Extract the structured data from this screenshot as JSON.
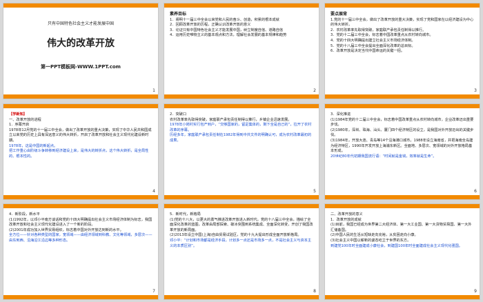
{
  "slides": [
    {
      "id": 1,
      "number": "1",
      "top_line": "只有中国特色社会主义才能发展中国",
      "title": "伟大的改革开放",
      "site": "第一PPT模板网-WWW.1PPT.com"
    },
    {
      "id": 2,
      "number": "2",
      "heading": "素养目标",
      "lines": [
        "1．阐明十一届三中全会以来党和人民的奋斗、创造，积累的根本成就",
        "2．回顾改革开放的历程，正确认识改革开放的意义",
        "3．论证只有中国特色社会主义才能发展中国，树立制度自信、道路自信",
        "4．运用历史唯物主义的基本观点和方法，理解社会发展的基本规律和趋势"
      ]
    },
    {
      "id": 3,
      "number": "3",
      "heading": "要点展背",
      "lines": [
        "1.党的十一届三中全会，做出了改革开放的重大决策，实现了党和国家在以经济建设为中心的伟大转折。",
        "2．农村改革率先取得突破，家庭联产承包责任制得以推行。",
        "3．党的十二届三中全会，标志着中国改革重点从农村转向城市。",
        "4．党的十四大明确提出建立社会主义市场经济体制。",
        "5．党的十八届三中全会提出全面深化改革的总目标。",
        "6．改革开放是决定当代中国命运的关键一招。"
      ]
    },
    {
      "id": 4,
      "number": "4",
      "lines": [
        "【学新知】",
        "一、改革开放的进程",
        "1．序幕开启",
        "1978年12月党的十一届三中全会，做出了改革开放的重大决策，实现了中华人民共和国成立以来党的历史上具有深远意义的伟大转折，开启了改革开放和社会主义现代化建设新时期。",
        "1978年，这是中国的新起点。",
        "把工作重心由阶级斗争转移到经济建设上来，是伟大的转折点，这个伟大转折，是全局性的、根本性的。"
      ]
    },
    {
      "id": 5,
      "number": "5",
      "lines": [
        "2．突破口",
        "农村改革率先取得突破，家庭联产承包责任制得以推行，乡镇企业迅速发展。",
        "1978年小岗村实行包产到户，“交够国家的，留足集体的，剩下全是自己的”，拉开了农村改革的序幕。",
        "历经多年，家庭联产承包责任制在1982年得到中共文件的明确认可，成为农村改革最初的成果。"
      ]
    },
    {
      "id": 6,
      "number": "6",
      "lines": [
        "3．深化推进",
        "(1)1984年党的十二届三中全会，标志着中国改革重点从农村转向城市，企业改革迈出重要步伐。",
        "(2)1980年，深圳、珠海、汕头、厦门四个经济特区的设立，是我国对外开放迈出的关键步伐。",
        "(3)1984年，开放大连、青岛等14个沿海港口城市。1988年设立海南省，并把海南全岛建为经济特区，1990年开发开放上海浦东新区。全面地、多层次、宽领域的对外开放格局基本形成。",
        "20世纪80年代初期我国流行语：“时间就是金钱，效率就是生命”。"
      ]
    },
    {
      "id": 7,
      "number": "7",
      "lines": [
        "4．新阶段，新水平",
        "(1)1992年，以邓小平南方谈话和党的十四大明确提出社会主义市场经济体制为标志，我国改革开放和社会主义现代化建设进入了一个新的阶段。",
        "(2)2001年成功加入世界贸易组织，标志着中国对外开放达到新的水平。",
        "全方位——针对各种类型的国家，宽领域——由经济领域到科教、文化等领域，多层次——由东到西、沿海沿江沿边等多种形态。"
      ]
    },
    {
      "id": 8,
      "number": "8",
      "lines": [
        "5．新时代，新格局",
        "(1)党的十八大，以更大的勇气推进改革开放进入新时代，党的十八届三中全会，描绘了全面深化改革的蓝图，改革由局部探索、破冰突围到系统集成、全面深化转变，开创了我国改革开放的新局面。",
        "(2)2013年设立中国(上海)自由贸易试验区，党的十九大提出形成全面开放新格局。",
        "邓小平：“计划和市场都是经济手段，计划多一点还是市场多一点，不是社会主义与资本主义的本质区别”。"
      ]
    },
    {
      "id": 9,
      "number": "9",
      "lines": [
        "二、改革开放的意义",
        "1．改革开放的成就",
        "(1)目前，我国已经成为世界第二大经济体、第一大工业国、第一大货物贸易国、第一大外汇储备国。",
        "(2)中国人民的生活从短缺走向充裕，从贫困走向小康。",
        "(3)社会主义中国以崭新的姿态屹立于世界的东方。",
        "到建党100年时全面建成小康社会，到建国100年时全面建成社会主义现代化强国。"
      ]
    }
  ]
}
